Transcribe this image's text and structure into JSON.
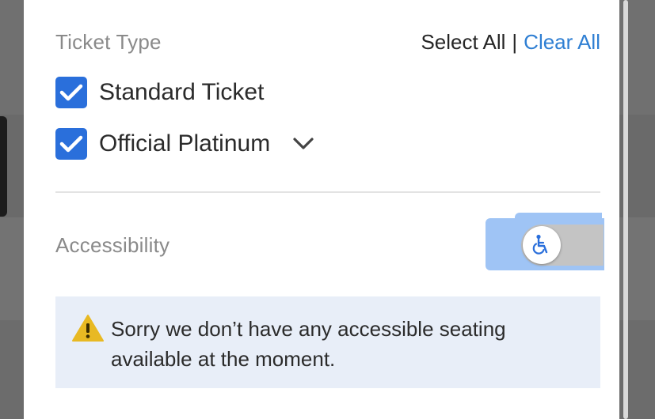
{
  "filters": {
    "ticket_type": {
      "title": "Ticket Type",
      "select_all_label": "Select All",
      "separator": "|",
      "clear_all_label": "Clear All",
      "options": [
        {
          "label": "Standard Ticket",
          "checked": true
        },
        {
          "label": "Official Platinum",
          "checked": true,
          "expandable": true
        }
      ]
    },
    "accessibility": {
      "title": "Accessibility",
      "toggle_on": false,
      "toggle_icon": "wheelchair-icon",
      "alert": {
        "icon": "warning-icon",
        "message": "Sorry we don’t have any accessible seating available at the moment."
      }
    }
  },
  "colors": {
    "accent": "#2f7fd3",
    "checkbox": "#2a6fdb",
    "alert_background": "#e8eef8",
    "focus_ring": "#9fc4f5",
    "warning": "#e8b923"
  }
}
